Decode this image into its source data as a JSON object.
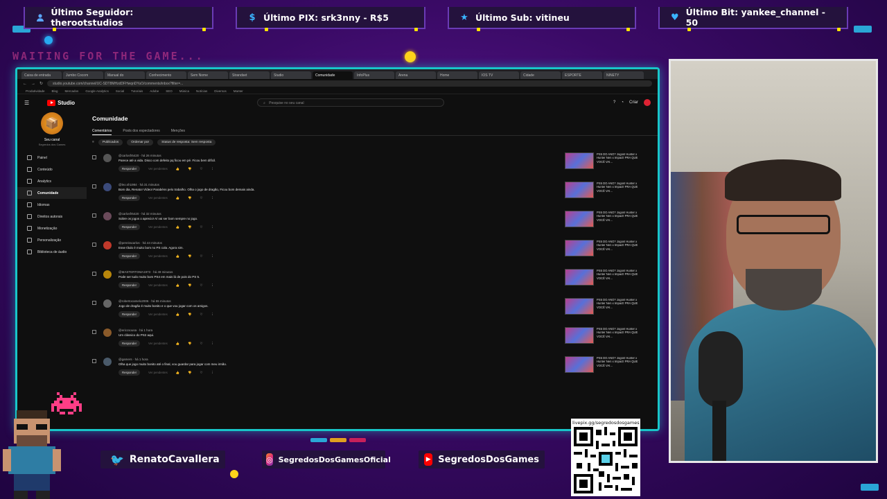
{
  "alerts": {
    "follower": "Último Seguidor: therootstudios",
    "pix": "Último PIX: srk3nny - R$5",
    "sub": "Último Sub: vitineu",
    "bit": "Último Bit: yankee_channel - 50"
  },
  "waiting_text": "WAITING FOR THE GAME...",
  "browser": {
    "tabs": [
      "Caixa de entrada",
      "Jumbo Cocom",
      "Manual do",
      "Conhecimento",
      "Sem Nome",
      "Strandset",
      "Studio",
      "Comunidade",
      "InfoPlus",
      "Arena",
      "Home",
      "IOS TV",
      "Cidade",
      "ESPORTE",
      "NINETY"
    ],
    "address": "studio.youtube.com/channel/UC-SDT8MHzdDFHwqnDYuO/comments/inbox?filter=...",
    "bookmarks": [
      "Produtividade",
      "Blog",
      "Mercados",
      "Google Analytics",
      "Social",
      "Tutoriais",
      "Adobe",
      "SEO",
      "Música",
      "Notícias",
      "Diversos",
      "Manter"
    ]
  },
  "studio": {
    "logo_text": "Studio",
    "search_placeholder": "Pesquise no seu canal",
    "create_label": "Criar",
    "channel_name": "Seu canal",
    "channel_sub": "Segredos dos Games",
    "nav": [
      {
        "label": "Painel"
      },
      {
        "label": "Conteúdo"
      },
      {
        "label": "Analytics"
      },
      {
        "label": "Comunidade"
      },
      {
        "label": "Idiomas"
      },
      {
        "label": "Direitos autorais"
      },
      {
        "label": "Monetização"
      },
      {
        "label": "Personalização"
      },
      {
        "label": "Biblioteca de áudio"
      }
    ],
    "page_title": "Comunidade",
    "tabs": [
      "Comentários",
      "Posts dos espectadores",
      "Menções"
    ],
    "filters": [
      "Publicados",
      "Ordenar por",
      "Status de resposta: Sem resposta"
    ],
    "reply_label": "Responder",
    "comments": [
      {
        "author": "@carlosfr5420 · há 26 minutos",
        "text": "Parece até a vida. Disco com defeito pq ficou em pé. Ficou bem difícil."
      },
      {
        "author": "@leo.sh1984 · há 31 minutos",
        "text": "Bom dia, Renato! Vídeo! Parabéns pelo trabalho. Olha o jogo de dragão, Ficou bom demais ainda."
      },
      {
        "author": "@carlosfr5420 · há 32 minutos",
        "text": "Sobre os jogos o aprecio! Aí vai ser bom sempre no jogo."
      },
      {
        "author": "@pereiracarlos · há 44 minutos",
        "text": "Esse título é muito bom no PS cola. Agora sim."
      },
      {
        "author": "@MASTERTOMA1973 · há 49 minutos",
        "text": "Pode ser tudo muito bom PS4 em mais lá de pois do PS 5."
      },
      {
        "author": "@robertocamelo2006 · há 55 minutos",
        "text": "Jogo de dragão é muito bonito e o que vou jogar com os amigos."
      },
      {
        "author": "@ericcsousa · há 1 hora",
        "text": "Um clássico do PS2 aqui."
      },
      {
        "author": "@gamers · há 1 hora",
        "text": "Olha que jogo muito bonito até o final, vou guardar para jogar com meu irmão."
      }
    ],
    "comment_pending": "Ver pendentes",
    "video_title": "PS5 DO ANO? Jogos! Hunter x Hunter Nen x Impact! PRA QUE VOCÊ VAI..."
  },
  "social": {
    "twitter": "RenatoCavallera",
    "instagram": "SegredosDosGamesOficial",
    "youtube": "SegredosDosGames"
  },
  "qr_label": "livepix.gg/segredosdosgames",
  "colors": {
    "background": "#3a0a66",
    "frame_accent": "#18c6c9",
    "alert_bg": "#24123d",
    "yellow_dot": "#ffd21a",
    "youtube_red": "#ff0000"
  },
  "icons": {
    "follower": "user-icon",
    "pix": "dollar-icon",
    "sub": "star-icon",
    "bit": "heart-icon"
  }
}
